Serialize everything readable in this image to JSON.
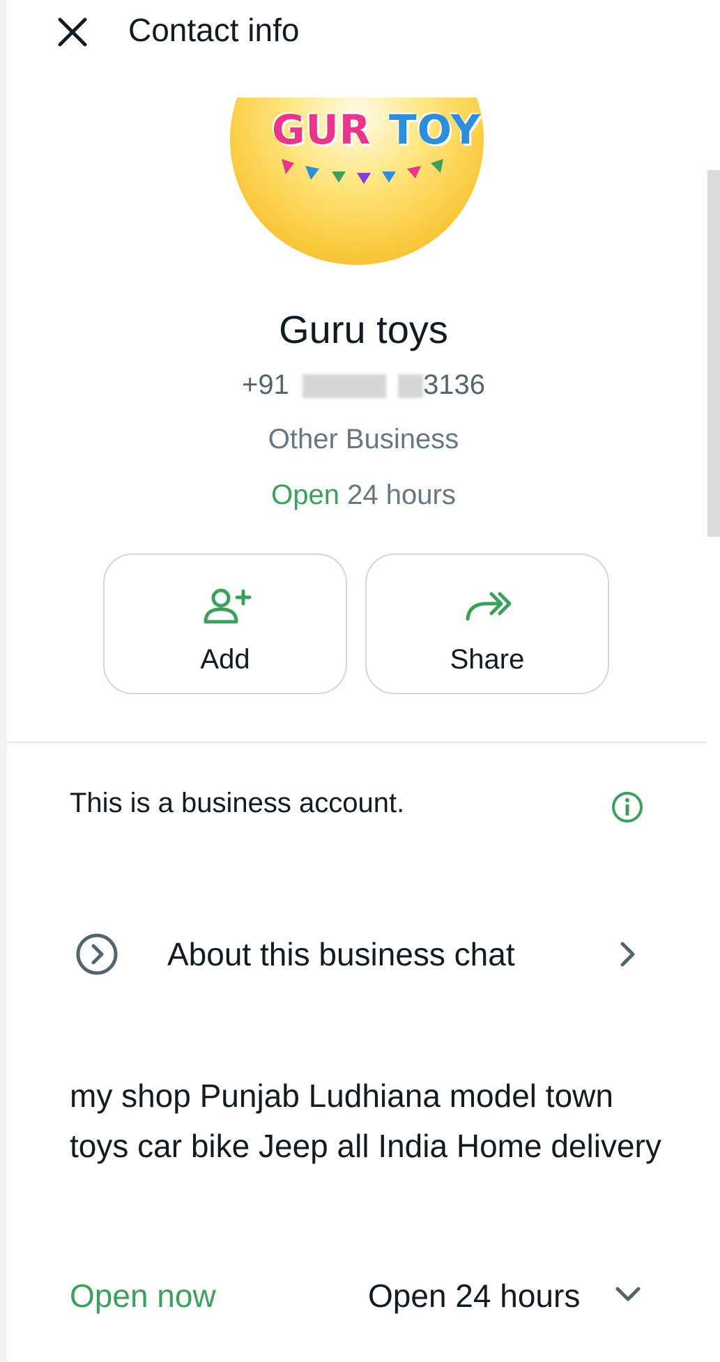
{
  "header": {
    "title": "Contact info"
  },
  "profile": {
    "logo_left": "GUR",
    "logo_right": "TOY",
    "name": "Guru toys",
    "phone_prefix": "+91",
    "phone_suffix": "3136",
    "category": "Other Business",
    "hours_status": "Open",
    "hours_text": "24 hours"
  },
  "actions": {
    "add_label": "Add",
    "share_label": "Share"
  },
  "business": {
    "notice": "This is a business account.",
    "about_label": "About this business chat",
    "description": "my shop Punjab Ludhiana model town toys car bike Jeep all India Home delivery",
    "open_status": "Open now",
    "open_hours": "Open 24 hours"
  },
  "colors": {
    "accent_green": "#3d9f5c",
    "text_primary": "#111b21",
    "text_secondary": "#667781"
  }
}
